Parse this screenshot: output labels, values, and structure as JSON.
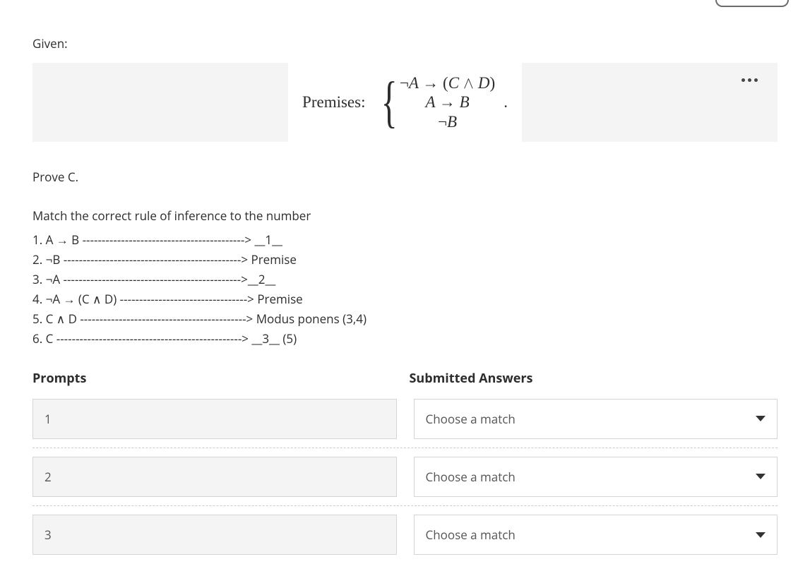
{
  "given_label": "Given:",
  "premises": {
    "label": "Premises:",
    "lines": [
      "¬A → (C ∧ D)",
      "A → B",
      "¬B"
    ]
  },
  "prove_label": "Prove C.",
  "instruction": "Match the correct rule of inference to the number",
  "proof": [
    "1. A → B ------------------------------------------> __1__",
    "2. ¬B ----------------------------------------------> Premise",
    "3. ¬A ---------------------------------------------->__2__",
    "4. ¬A → (C ∧ D) ---------------------------------> Premise",
    "5. C ∧ D -------------------------------------------> Modus ponens (3,4)",
    "6. C ------------------------------------------------> __3__ (5)"
  ],
  "headers": {
    "prompts": "Prompts",
    "answers": "Submitted Answers"
  },
  "rows": [
    {
      "prompt": "1",
      "answer": "Choose a match"
    },
    {
      "prompt": "2",
      "answer": "Choose a match"
    },
    {
      "prompt": "3",
      "answer": "Choose a match"
    }
  ]
}
